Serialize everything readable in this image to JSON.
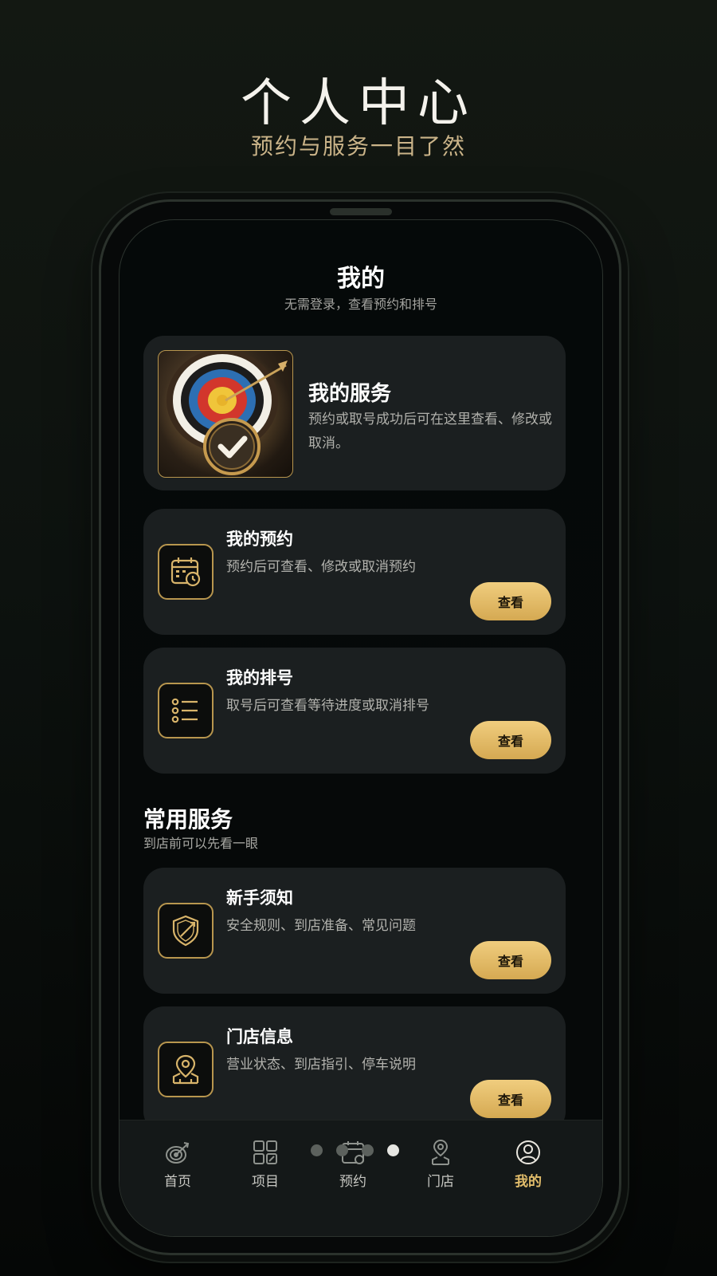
{
  "hero": {
    "title": "个人中心",
    "subtitle": "预约与服务一目了然"
  },
  "page": {
    "title": "我的",
    "subtitle": "无需登录，查看预约和排号"
  },
  "service_card": {
    "title": "我的服务",
    "description": "预约或取号成功后可在这里查看、修改或取消。",
    "image": "archery-target-checkmark"
  },
  "cards": [
    {
      "title": "我的预约",
      "description": "预约后可查看、修改或取消预约",
      "button": "查看",
      "icon": "calendar-clock-icon"
    },
    {
      "title": "我的排号",
      "description": "取号后可查看等待进度或取消排号",
      "button": "查看",
      "icon": "list-icon"
    },
    {
      "title": "新手须知",
      "description": "安全规则、到店准备、常见问题",
      "button": "查看",
      "icon": "shield-arrow-icon"
    },
    {
      "title": "门店信息",
      "description": "营业状态、到店指引、停车说明",
      "button": "查看",
      "icon": "store-location-icon"
    }
  ],
  "section": {
    "title": "常用服务",
    "subtitle": "到店前可以先看一眼"
  },
  "tabs": [
    {
      "label": "首页",
      "icon": "target-icon",
      "active": false
    },
    {
      "label": "项目",
      "icon": "grid-icon",
      "active": false
    },
    {
      "label": "预约",
      "icon": "calendar-icon",
      "active": false
    },
    {
      "label": "门店",
      "icon": "location-person-icon",
      "active": false
    },
    {
      "label": "我的",
      "icon": "user-icon",
      "active": true
    }
  ],
  "page_indicator": {
    "count": 4,
    "active_index": 3
  },
  "colors": {
    "accent": "#e2bd6b",
    "button_gradient_top": "#f0cd7e",
    "button_gradient_bottom": "#d5a952",
    "card_bg": "#1b1f20"
  }
}
